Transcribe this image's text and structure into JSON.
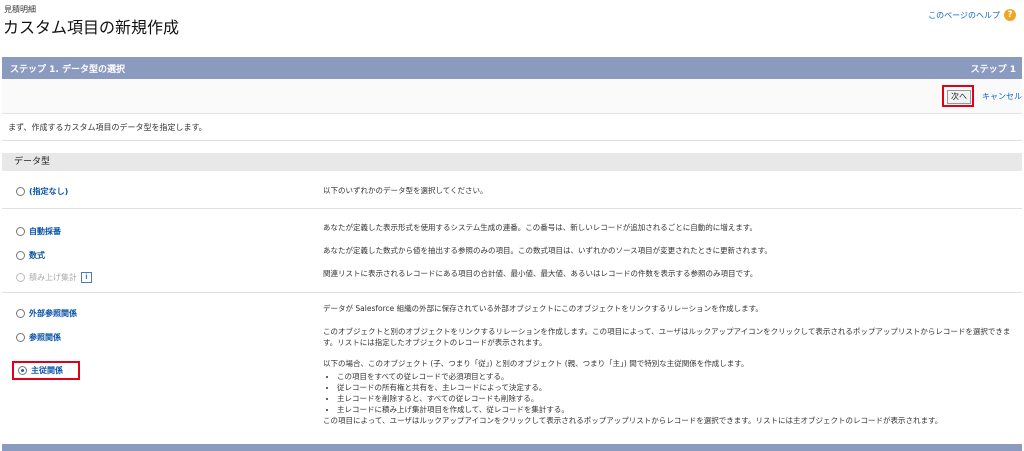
{
  "header": {
    "breadcrumb": "見積明細",
    "title": "カスタム項目の新規作成",
    "help_link": "このページのヘルプ",
    "help_icon": "help-icon"
  },
  "step_bar": {
    "title": "ステップ 1. データ型の選択",
    "step": "ステップ 1"
  },
  "buttons": {
    "next": "次へ",
    "cancel": "キャンセル"
  },
  "intro": "まず、作成するカスタム項目のデータ型を指定します。",
  "section_title": "データ型",
  "options": [
    {
      "label": "(指定なし)",
      "checked": false,
      "disabled": false,
      "desc": "以下のいずれかのデータ型を選択してください。"
    },
    {
      "label": "自動採番",
      "checked": false,
      "disabled": false,
      "desc": "あなたが定義した表示形式を使用するシステム生成の連番。この番号は、新しいレコードが追加されるごとに自動的に増えます。"
    },
    {
      "label": "数式",
      "checked": false,
      "disabled": false,
      "desc": "あなたが定義した数式から値を抽出する参照のみの項目。この数式項目は、いずれかのソース項目が変更されたときに更新されます。"
    },
    {
      "label": "積み上げ集計",
      "checked": false,
      "disabled": true,
      "desc": "関連リストに表示されるレコードにある項目の合計値、最小値、最大値、あるいはレコードの件数を表示する参照のみ項目です。"
    },
    {
      "label": "外部参照関係",
      "checked": false,
      "disabled": false,
      "desc": "データが Salesforce 組織の外部に保存されている外部オブジェクトにこのオブジェクトをリンクするリレーションを作成します。"
    },
    {
      "label": "参照関係",
      "checked": false,
      "disabled": false,
      "desc": "このオブジェクトと別のオブジェクトをリンクするリレーションを作成します。この項目によって、ユーザはルックアップアイコンをクリックして表示されるポップアップリストからレコードを選択できます。リストには指定したオブジェクトのレコードが表示されます。"
    },
    {
      "label": "主従関係",
      "checked": true,
      "disabled": false,
      "desc": "以下の場合、このオブジェクト (子、つまり「従」) と別のオブジェクト (親、つまり「主」) 間で特別な主従関係を作成します。",
      "bullets": [
        "この項目をすべての従レコードで必須項目とする。",
        "従レコードの所有権と共有を、主レコードによって決定する。",
        "主レコードを削除すると、すべての従レコードも削除する。",
        "主レコードに積み上げ集計項目を作成して、従レコードを集計する。"
      ],
      "footer": "この項目によって、ユーザはルックアップアイコンをクリックして表示されるポップアップリストからレコードを選択できます。リストには主オブジェクトのレコードが表示されます。"
    }
  ]
}
